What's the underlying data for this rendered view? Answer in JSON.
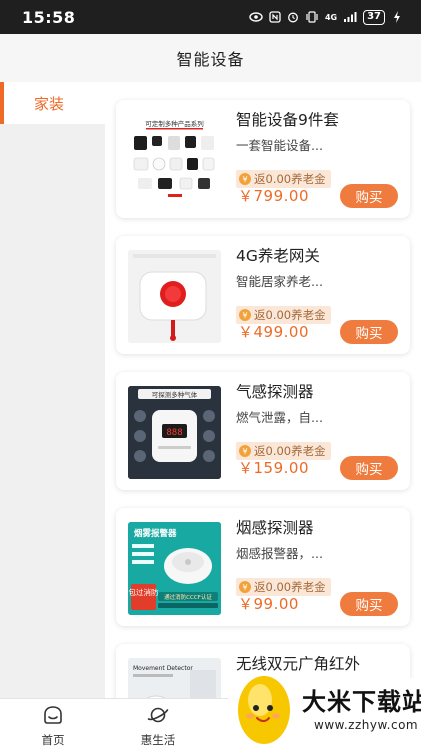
{
  "status_bar": {
    "time": "15:58",
    "battery": "37",
    "network": "4G"
  },
  "header": {
    "title": "智能设备"
  },
  "sidebar": {
    "items": [
      {
        "label": "家装"
      }
    ]
  },
  "products": [
    {
      "name": "智能设备9件套",
      "desc": "一套智能设备...",
      "rebate": "返0.00养老金",
      "price": "￥799.00",
      "buy": "购买",
      "thumb_caption": "可定制多种产品系列"
    },
    {
      "name": "4G养老网关",
      "desc": "智能居家养老...",
      "rebate": "返0.00养老金",
      "price": "￥499.00",
      "buy": "购买",
      "thumb_caption": ""
    },
    {
      "name": "气感探测器",
      "desc": "燃气泄露，自...",
      "rebate": "返0.00养老金",
      "price": "￥159.00",
      "buy": "购买",
      "thumb_caption": "可探测多种气体"
    },
    {
      "name": "烟感探测器",
      "desc": "烟感报警器，...",
      "rebate": "返0.00养老金",
      "price": "￥99.00",
      "buy": "购买",
      "thumb_caption": "烟雾报警器",
      "thumb_badge": "包过消防",
      "thumb_note": "通过消防CCCF认证"
    },
    {
      "name": "无线双元广角红外",
      "desc": "",
      "rebate": "",
      "price": "",
      "buy": "",
      "thumb_caption": "Movement Detector"
    }
  ],
  "tabbar": {
    "items": [
      {
        "label": "首页",
        "icon": "home-icon"
      },
      {
        "label": "惠生活",
        "icon": "planet-icon"
      }
    ]
  },
  "watermark": {
    "text": "大米下载站",
    "url": "www.zzhyw.com"
  },
  "colors": {
    "accent": "#ee6a26",
    "buy_button": "#f07b3f",
    "status_bar": "#1f1f1f"
  }
}
